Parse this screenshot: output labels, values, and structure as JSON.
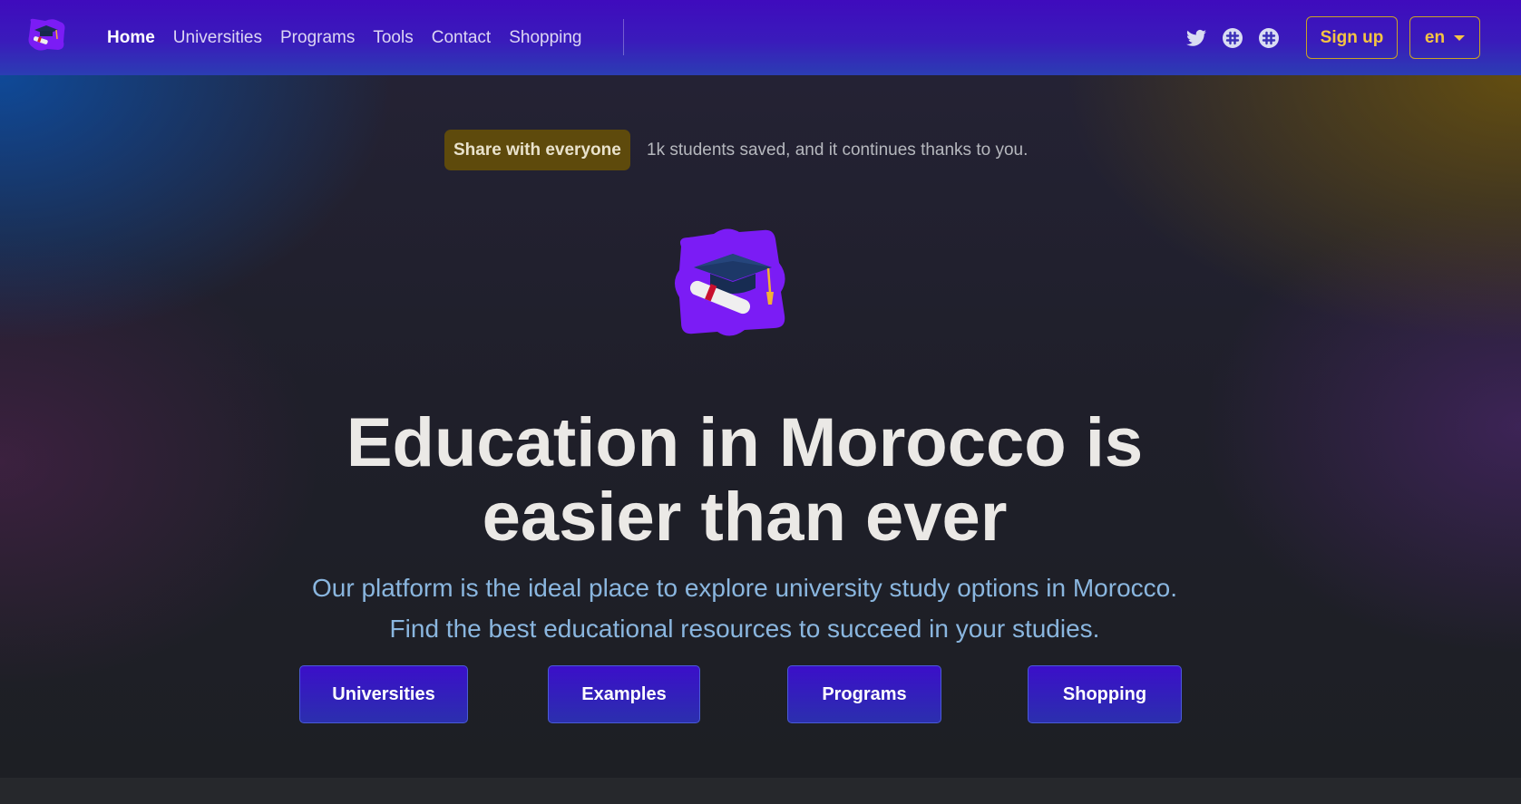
{
  "nav": {
    "links": [
      "Home",
      "Universities",
      "Programs",
      "Tools",
      "Contact",
      "Shopping"
    ],
    "active": "Home",
    "social_icons": [
      "twitter-icon",
      "slack-icon",
      "slack-icon"
    ],
    "signup_label": "Sign up",
    "lang_label": "en"
  },
  "hero": {
    "badge": "Share with everyone",
    "badge_text": "1k students saved, and it continues thanks to you.",
    "title_line1": "Education in Morocco is",
    "title_line2": "easier than ever",
    "subtitle_line1": "Our platform is the ideal place to explore university study options in Morocco.",
    "subtitle_line2": "Find the best educational resources to succeed in your studies.",
    "buttons": [
      "Universities",
      "Examples",
      "Programs",
      "Shopping"
    ]
  },
  "colors": {
    "nav_top": "#3f0bbd",
    "nav_bottom": "#2b3db3",
    "accent_gold": "#f5c542",
    "badge_bg": "#5e4a0c",
    "subtitle": "#8ab6df",
    "cta_bg": "#3b0fc9",
    "logo_purple": "#7b1cf5"
  }
}
